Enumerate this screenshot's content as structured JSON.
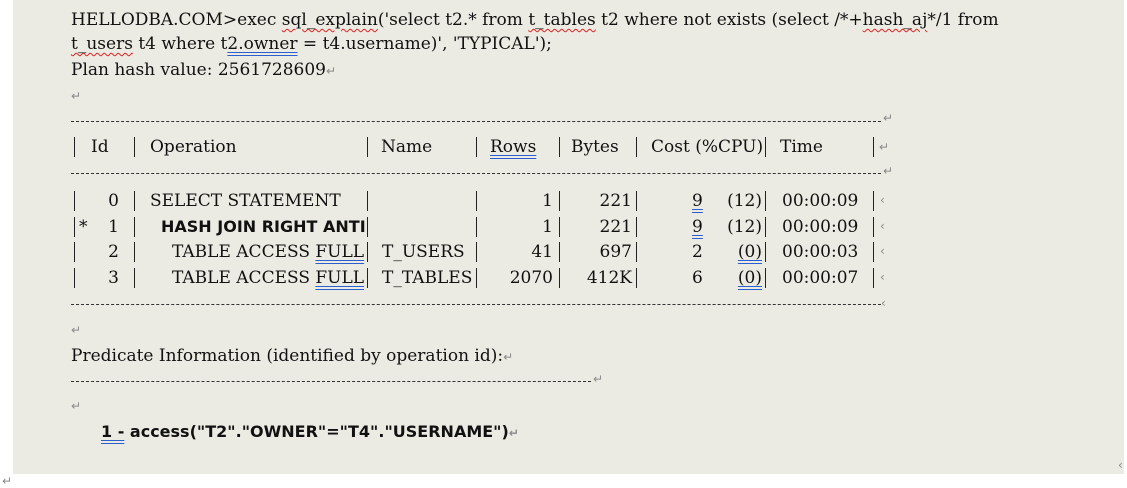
{
  "sql": {
    "prompt": "HELLODBA.COM>",
    "cmd_1": "exec ",
    "cmd_proc": "sql_explain",
    "cmd_2": "('select t2.* from ",
    "cmd_tbl": "t_tables",
    "cmd_3": " t2 where not exists (select /*+",
    "cmd_hint": "hash_aj",
    "cmd_4": "*/1 from",
    "cmd_users": "t_users",
    "cmd_5": " t4 where t",
    "cmd_owner": "2.owner",
    "cmd_6": " = t4.username)', 'TYPICAL');"
  },
  "plan_hash": "Plan hash value: 2561728609",
  "mark": "↵",
  "small_mark": "‹",
  "plan_table": {
    "headers": {
      "id": "Id",
      "operation": "Operation",
      "name": "Name",
      "rows": "Rows",
      "bytes": "Bytes",
      "cost": "Cost (%CPU)",
      "time": "Time"
    },
    "rows": [
      {
        "flag": "",
        "id": "0",
        "operation": "SELECT STATEMENT",
        "name": "",
        "rows": "1",
        "bytes": "221",
        "cost": "9",
        "cpu": "(12)",
        "time": "00:00:09"
      },
      {
        "flag": "*",
        "id": "1",
        "operation": "HASH JOIN RIGHT ANTI",
        "name": "",
        "rows": "1",
        "bytes": "221",
        "cost": "9",
        "cpu": "(12)",
        "time": "00:00:09"
      },
      {
        "flag": "",
        "id": "2",
        "operation": "TABLE ACCESS ",
        "op_underlined": "FULL",
        "name": "T_USERS",
        "rows": "41",
        "bytes": "697",
        "cost": "2",
        "cpu": "(0)",
        "time": "00:00:03"
      },
      {
        "flag": "",
        "id": "3",
        "operation": "TABLE ACCESS ",
        "op_underlined": "FULL",
        "name": "T_TABLES",
        "rows": "2070",
        "bytes": "412K",
        "cost": "6",
        "cpu": "(0)",
        "time": "00:00:07"
      }
    ]
  },
  "predicate": {
    "title": "Predicate Information (identified by operation id):",
    "id": "1 -",
    "text": " access(\"T2\".\"OWNER\"=\"T4\".\"USERNAME\")"
  }
}
